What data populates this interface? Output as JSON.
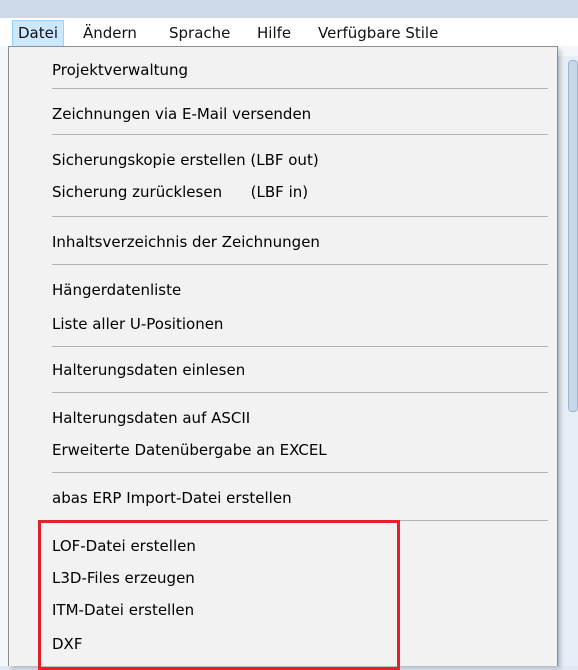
{
  "menubar": {
    "items": [
      {
        "label": "Datei",
        "active": true
      },
      {
        "label": "Ändern",
        "active": false
      },
      {
        "label": "Sprache",
        "active": false
      },
      {
        "label": "Hilfe",
        "active": false
      },
      {
        "label": "Verfügbare Stile",
        "active": false
      }
    ]
  },
  "dropdown": {
    "items": [
      {
        "label": "Projektverwaltung"
      },
      {
        "label": "Zeichnungen via E-Mail versenden"
      },
      {
        "label": "Sicherungskopie erstellen (LBF out)"
      },
      {
        "label": "Sicherung zurücklesen      (LBF in)"
      },
      {
        "label": "Inhaltsverzeichnis der Zeichnungen"
      },
      {
        "label": "Hängerdatenliste"
      },
      {
        "label": "Liste aller U-Positionen"
      },
      {
        "label": "Halterungsdaten einlesen"
      },
      {
        "label": "Halterungsdaten auf ASCII"
      },
      {
        "label": "Erweiterte Datenübergabe an EXCEL"
      },
      {
        "label": "abas ERP Import-Datei erstellen"
      },
      {
        "label": "LOF-Datei erstellen"
      },
      {
        "label": "L3D-Files erzeugen"
      },
      {
        "label": "ITM-Datei erstellen"
      },
      {
        "label": "DXF"
      }
    ]
  },
  "colors": {
    "highlight_box": "#e3212a",
    "active_menu_bg": "#cce8ff"
  }
}
